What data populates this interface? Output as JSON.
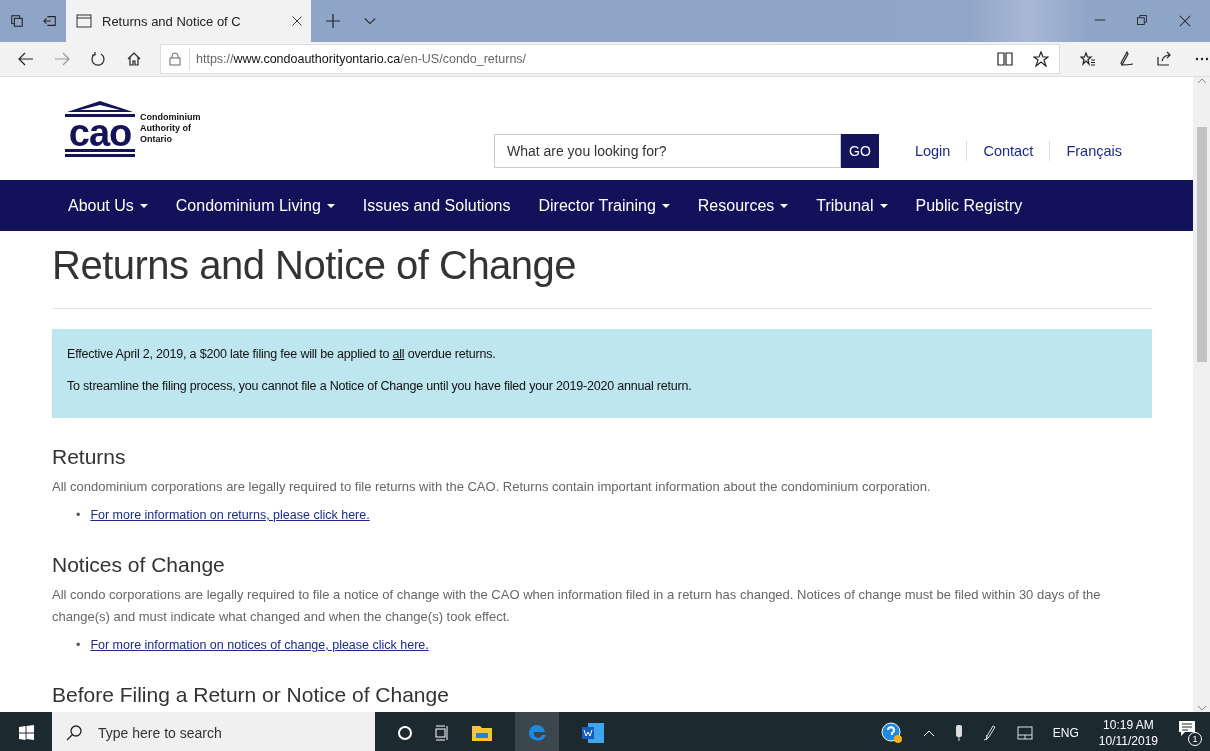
{
  "browser": {
    "tab_title": "Returns and Notice of C",
    "url": {
      "scheme": "https://",
      "host": "www.condoauthorityontario.ca",
      "path": "/en-US/condo_returns/"
    }
  },
  "header": {
    "logo_mark": "cao",
    "logo_lines": [
      "Condominium",
      "Authority of",
      "Ontario"
    ],
    "search": {
      "placeholder": "What are you looking for?",
      "button": "GO"
    },
    "links": [
      "Login",
      "Contact",
      "Français"
    ]
  },
  "nav": [
    {
      "label": "About Us",
      "has_menu": true
    },
    {
      "label": "Condominium Living",
      "has_menu": true
    },
    {
      "label": "Issues and Solutions",
      "has_menu": false
    },
    {
      "label": "Director Training",
      "has_menu": true
    },
    {
      "label": "Resources",
      "has_menu": true
    },
    {
      "label": "Tribunal",
      "has_menu": true
    },
    {
      "label": "Public Registry",
      "has_menu": false
    }
  ],
  "page_title": "Returns and Notice of Change",
  "notice": {
    "lines": [
      {
        "before": "Effective April 2, 2019, a $200 late filing fee will be applied to",
        "underlined": "all",
        "after": "overdue returns."
      },
      {
        "before": "To streamline the filing process, you cannot file a Notice of Change until you have filed your 2019-2020 annual return."
      }
    ]
  },
  "sections": [
    {
      "heading": "Returns",
      "text": "All condominium corporations are legally required to file returns with the CAO. Returns contain important information about the condominium corporation.",
      "links": [
        {
          "bullet": "•",
          "text": "For more information on returns, please click here."
        }
      ]
    },
    {
      "heading": "Notices of Change",
      "text": "All condo corporations are legally required to file a notice of change with the CAO when information filed in a return has changed. Notices of change must be filed within 30 days of the change(s) and must indicate what changed and when the change(s) took effect.",
      "links": [
        {
          "bullet": "•",
          "text": "For more information on notices of change, please click here."
        }
      ]
    },
    {
      "heading": "Before Filing a Return or Notice of Change"
    }
  ],
  "taskbar": {
    "search_placeholder": "Type here to search",
    "language": "ENG",
    "time": "10:19 AM",
    "date": "10/11/2019",
    "notification_count": "1"
  }
}
